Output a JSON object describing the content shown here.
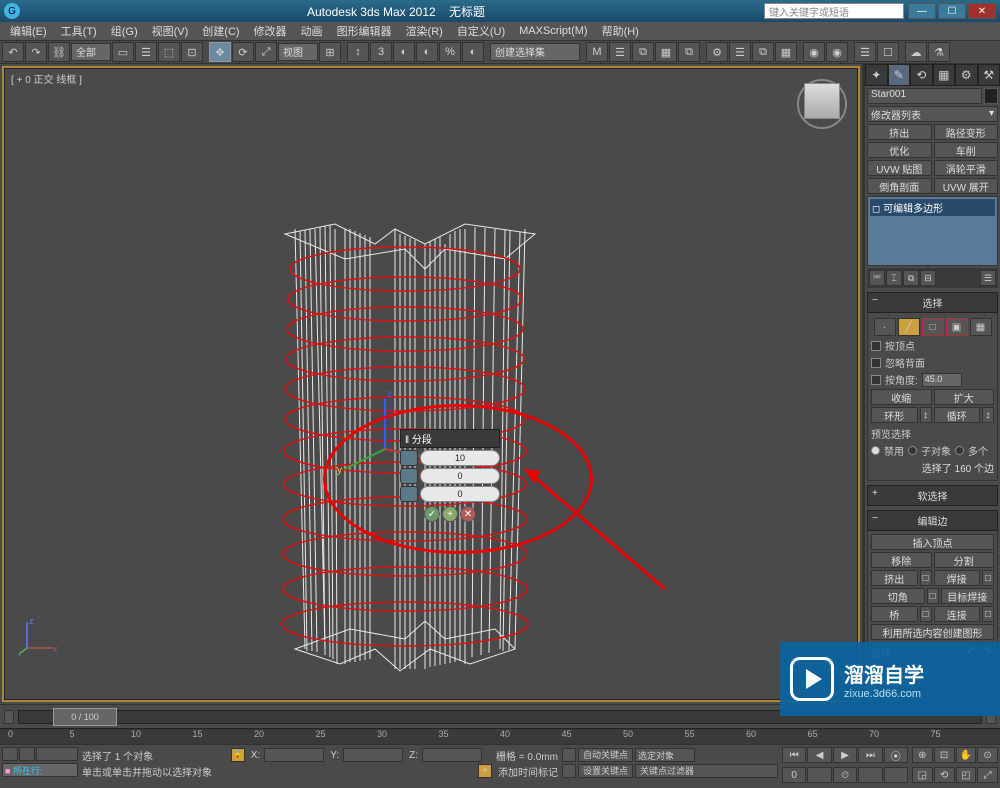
{
  "title": {
    "app": "Autodesk 3ds Max  2012",
    "doc": "无标题",
    "search_placeholder": "键入关键字或短语"
  },
  "win_btns": {
    "min": "—",
    "max": "☐",
    "close": "✕"
  },
  "menu": [
    "编辑(E)",
    "工具(T)",
    "组(G)",
    "视图(V)",
    "创建(C)",
    "修改器",
    "动画",
    "图形编辑器",
    "渲染(R)",
    "自定义(U)",
    "MAXScript(M)",
    "帮助(H)"
  ],
  "toolbar": {
    "scope": "全部",
    "btns": [
      "↶",
      "↷",
      "⛓",
      "|",
      "▦",
      "◫",
      "|",
      "⬚",
      "⬚",
      "⬚",
      "|",
      "↔",
      "⟳",
      "⤢",
      "|",
      "视图",
      "▾",
      "⊞",
      "|",
      "↕",
      "3",
      "↕",
      "|",
      "◐",
      "◐",
      "◐",
      "◐",
      "|"
    ],
    "selset": "创建选择集",
    "right": [
      "M",
      "☰",
      "⧉",
      "▦",
      "⧉",
      "|",
      "⚙",
      "☰",
      "⧉",
      "▦",
      "|",
      "◉",
      "◉",
      "|",
      "☰",
      "☐",
      "|",
      "☁",
      "⚗"
    ]
  },
  "viewport": {
    "label": "[ + 0 正交 线框 ]"
  },
  "caddy": {
    "title": "‖ 分段",
    "spin1": "10",
    "spin2": "0",
    "spin3": "0"
  },
  "panel": {
    "tabs": [
      "✦",
      "✎",
      "⟲",
      "▦",
      "⚙",
      "⚒"
    ],
    "obj_name": "Star001",
    "modifier_dd": "修改器列表",
    "quick_btns": [
      [
        "挤出",
        "路径变形"
      ],
      [
        "优化",
        "车削"
      ],
      [
        "UVW 贴图",
        "涡轮平滑"
      ],
      [
        "倒角剖面",
        "UVW 展开"
      ]
    ],
    "stack_item": "可编辑多边形",
    "stack_tools": [
      "⎃",
      "⌶",
      "|",
      "⧉",
      "⊟",
      "✓",
      "☰"
    ],
    "rollout_select": {
      "title": "选择",
      "sub_btns": [
        "·",
        "╱",
        "□",
        "▣",
        "▦"
      ],
      "by_vertex": "按顶点",
      "ignore_back": "忽略背面",
      "by_angle": "按角度:",
      "angle_val": "45.0",
      "shrink": "收缩",
      "grow": "扩大",
      "ring": "环形",
      "loop": "循环",
      "preview_lbl": "预览选择",
      "radios": [
        "禁用",
        "子对象",
        "多个"
      ],
      "selected_info": "选择了 160 个边"
    },
    "rollout_soft": "软选择",
    "rollout_edit": {
      "title": "编辑边",
      "insert_v": "插入顶点",
      "btns": [
        [
          "移除",
          "分割"
        ],
        [
          "挤出",
          "焊接"
        ],
        [
          "切角",
          "目标焊接"
        ],
        [
          "桥",
          "连接"
        ]
      ],
      "create_shape": "利用所选内容创建图形",
      "rotate": "旋转"
    }
  },
  "timeline": {
    "handle": "0 / 100",
    "ticks": [
      "0",
      "5",
      "10",
      "15",
      "20",
      "25",
      "30",
      "35",
      "40",
      "45",
      "50",
      "55",
      "60",
      "65",
      "70",
      "75"
    ]
  },
  "status": {
    "script_label": "所在行:",
    "sel_info": "选择了 1 个对象",
    "prompt": "单击或单击并拖动以选择对象",
    "lock": "🔒",
    "add_time_tag": "添加时间标记",
    "coords": {
      "x": "X:",
      "y": "Y:",
      "z": "Z:"
    },
    "grid": "栅格 = 0.0mm",
    "auto_key": "自动关键点",
    "set_key": "设置关键点",
    "sel_filter": "选定对象",
    "key_filter": "关键点过滤器",
    "play": [
      "⏮",
      "◀",
      "▶",
      "⏭",
      "⦿"
    ],
    "play2": [
      "0",
      "",
      "⏲",
      "",
      ""
    ],
    "nav": [
      "⊕",
      "⊡",
      "✋",
      "⊙",
      "◲",
      "⟲",
      "◰",
      "⤢"
    ]
  },
  "watermark": {
    "brand": "溜溜自学",
    "url": "zixue.3d66.com"
  }
}
